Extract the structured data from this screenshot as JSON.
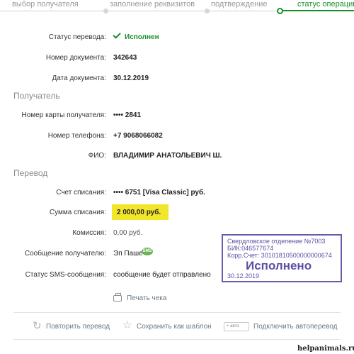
{
  "stepper": {
    "steps": [
      {
        "label": "выбор получателя",
        "active": false
      },
      {
        "label": "заполнение реквизитов",
        "active": false
      },
      {
        "label": "подтверждение",
        "active": false
      },
      {
        "label": "статус операции",
        "active": true
      }
    ]
  },
  "details": {
    "status_label": "Статус перевода:",
    "status_value": "Исполнен",
    "doc_number_label": "Номер документа:",
    "doc_number_value": "342643",
    "doc_date_label": "Дата документа:",
    "doc_date_value": "30.12.2019"
  },
  "recipient": {
    "title": "Получатель",
    "card_label": "Номер карты получателя:",
    "card_value": "•••• 2841",
    "phone_label": "Номер телефона:",
    "phone_value": "+7 9068066082",
    "name_label": "ФИО:",
    "name_value": "ВЛАДИМИР АНАТОЛЬЕВИЧ Ш."
  },
  "transfer": {
    "title": "Перевод",
    "account_label": "Счет списания:",
    "account_value": "•••• 6751  [Visa Classic]  руб.",
    "amount_label": "Сумма списания:",
    "amount_value": "2 000,00  руб.",
    "fee_label": "Комиссия:",
    "fee_value": "0,00 руб.",
    "message_label": "Сообщение получателю:",
    "message_value": "Эп Паше",
    "sms_badge": "SMS",
    "sms_status_label": "Статус SMS-сообщения:",
    "sms_status_value": "сообщение будет отправлено"
  },
  "print_label": "Печать чека",
  "actions": {
    "repeat": "Повторить перевод",
    "save_template": "Сохранить как шаблон",
    "auto_badge": "+ авто",
    "autopay": "Подключить автоперевод"
  },
  "stamp": {
    "line1": "Свердловское отделение №7003",
    "line2": "БИК:046577674",
    "line3": "Корр.Счет: 30101810500000000674",
    "big": "Исполнено",
    "date": "30.12.2019"
  },
  "watermark": "helpanimals.ru",
  "colors": {
    "accent_green": "#1a8f2e",
    "highlight_yellow": "#f2e62a",
    "stamp_purple": "#5d4fa0",
    "link_blue": "#3a6fa8"
  }
}
